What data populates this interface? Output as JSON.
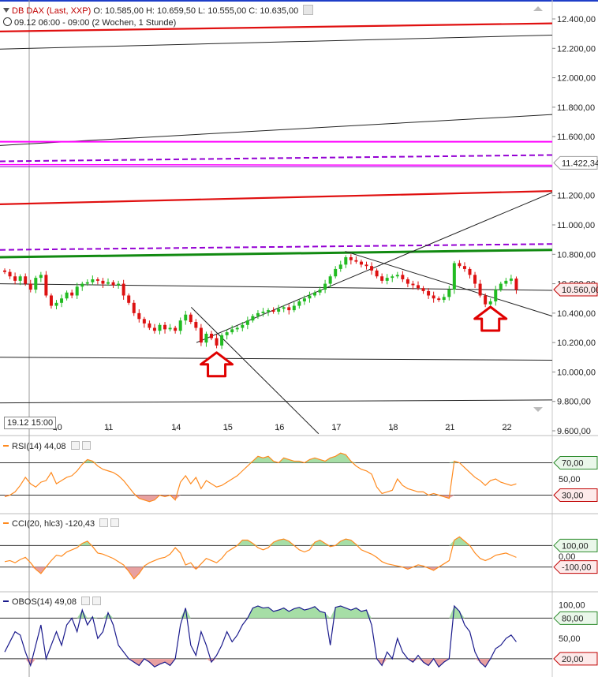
{
  "header": {
    "instrument": "DB DAX (Last, XXP)",
    "ohlc": "O: 10.585,00  H: 10.659,50  L: 10.555,00  C: 10.635,00",
    "period": "09.12 06:00 - 09:00 (2 Wochen, 1 Stunde)"
  },
  "date_marker": "19.12 15:00",
  "colors": {
    "up": "#22bb22",
    "down": "#dd1111",
    "indicator": "#ff8a1e",
    "obos": "#1a1a8c",
    "fill_high": "#a6dea6",
    "fill_low": "#e8a0a0",
    "axis_tag_green": "#2a8a2a",
    "axis_tag_red": "#c00000",
    "arrow": "#e00000"
  },
  "chart_data": [
    {
      "type": "candlestick",
      "title": "DB DAX",
      "y_ticks": [
        "12.400,00",
        "12.200,00",
        "12.000,00",
        "11.800,00",
        "11.600,00",
        "11.200,00",
        "11.000,00",
        "10.800,00",
        "10.600,00",
        "10.400,00",
        "10.200,00",
        "10.000,00",
        "9.800,00",
        "9.600,00"
      ],
      "y_tick_values": [
        12400,
        12200,
        12000,
        11800,
        11600,
        11200,
        11000,
        10800,
        10600,
        10400,
        10200,
        10000,
        9800,
        9600
      ],
      "ylim": [
        9600,
        12400
      ],
      "x_ticks": [
        "10",
        "11",
        "14",
        "15",
        "16",
        "17",
        "18",
        "21",
        "22"
      ],
      "x_tick_index": [
        10,
        20,
        33,
        43,
        53,
        64,
        75,
        86,
        97
      ],
      "tags": [
        {
          "label": "11.422,34",
          "value": 11422,
          "style": "neutral"
        },
        {
          "label": "10.560,00",
          "value": 10560,
          "style": "red"
        }
      ],
      "close": [
        10680,
        10650,
        10620,
        10650,
        10600,
        10560,
        10640,
        10660,
        10520,
        10450,
        10470,
        10500,
        10540,
        10520,
        10580,
        10600,
        10610,
        10630,
        10620,
        10600,
        10610,
        10590,
        10600,
        10520,
        10470,
        10400,
        10360,
        10330,
        10300,
        10280,
        10320,
        10290,
        10300,
        10280,
        10350,
        10390,
        10340,
        10300,
        10200,
        10260,
        10230,
        10180,
        10250,
        10270,
        10290,
        10300,
        10320,
        10350,
        10380,
        10400,
        10410,
        10420,
        10410,
        10430,
        10440,
        10420,
        10450,
        10480,
        10500,
        10520,
        10540,
        10560,
        10600,
        10650,
        10700,
        10730,
        10780,
        10760,
        10750,
        10730,
        10720,
        10690,
        10650,
        10620,
        10640,
        10650,
        10660,
        10630,
        10600,
        10590,
        10570,
        10550,
        10520,
        10500,
        10490,
        10510,
        10560,
        10740,
        10720,
        10700,
        10660,
        10600,
        10520,
        10460,
        10480,
        10560,
        10600,
        10620,
        10635,
        10560
      ],
      "lines": [
        {
          "name": "red-upper",
          "color": "#e01010",
          "width": 2.2,
          "from": [
            0,
            12315
          ],
          "to": [
            104,
            12370
          ]
        },
        {
          "name": "black-upper",
          "color": "#222222",
          "width": 1,
          "from": [
            0,
            12195
          ],
          "to": [
            104,
            12290
          ]
        },
        {
          "name": "black-channel-top",
          "color": "#222222",
          "width": 1,
          "from": [
            0,
            11540
          ],
          "to": [
            104,
            11750
          ]
        },
        {
          "name": "magenta-solid-1",
          "color": "#ff00ff",
          "width": 2,
          "from": [
            0,
            11565
          ],
          "to": [
            104,
            11565
          ]
        },
        {
          "name": "purple-dashed-1",
          "color": "#9400d3",
          "width": 2,
          "dash": "7,4",
          "from": [
            0,
            11432
          ],
          "to": [
            104,
            11475
          ]
        },
        {
          "name": "magenta-solid-2",
          "color": "#ff00ff",
          "width": 1.5,
          "from": [
            0,
            11410
          ],
          "to": [
            104,
            11405
          ]
        },
        {
          "name": "purple-solid-2",
          "color": "#9400d3",
          "width": 1,
          "from": [
            0,
            11395
          ],
          "to": [
            104,
            11395
          ]
        },
        {
          "name": "red-middle",
          "color": "#e01010",
          "width": 2.2,
          "from": [
            0,
            11140
          ],
          "to": [
            104,
            11230
          ]
        },
        {
          "name": "purple-dashed-2",
          "color": "#9400d3",
          "width": 2,
          "dash": "7,4",
          "from": [
            0,
            10830
          ],
          "to": [
            104,
            10870
          ]
        },
        {
          "name": "green-support",
          "color": "#118a11",
          "width": 3,
          "from": [
            0,
            10780
          ],
          "to": [
            104,
            10830
          ]
        },
        {
          "name": "black-horizontal-trend",
          "color": "#222222",
          "width": 1,
          "from": [
            0,
            10600
          ],
          "to": [
            104,
            10555
          ]
        },
        {
          "name": "black-uptrend",
          "color": "#222222",
          "width": 1,
          "from": [
            37,
            10200
          ],
          "to": [
            104,
            11220
          ]
        },
        {
          "name": "black-downtrend-short",
          "color": "#222222",
          "width": 1,
          "from": [
            36,
            10440
          ],
          "to": [
            60,
            9580
          ]
        },
        {
          "name": "black-downtrend-right",
          "color": "#222222",
          "width": 1,
          "from": [
            65,
            10820
          ],
          "to": [
            104,
            10380
          ]
        },
        {
          "name": "black-lower",
          "color": "#222222",
          "width": 1,
          "from": [
            0,
            10100
          ],
          "to": [
            104,
            10080
          ]
        },
        {
          "name": "black-bottom",
          "color": "#222222",
          "width": 1,
          "from": [
            0,
            9790
          ],
          "to": [
            104,
            9810
          ]
        }
      ],
      "arrows": [
        {
          "name": "buy-arrow-1",
          "index": 41,
          "value": 10100
        },
        {
          "name": "buy-arrow-2",
          "index": 94,
          "value": 10410
        }
      ]
    },
    {
      "type": "line",
      "title": "RSI(14)",
      "value_label": "44,08",
      "y_ticks": [
        "70,00",
        "50,00",
        "30,00"
      ],
      "y_tick_values": [
        70,
        50,
        30
      ],
      "ylim": [
        10,
        90
      ],
      "tags": [
        {
          "label": "70,00",
          "value": 70,
          "style": "green"
        },
        {
          "label": "30,00",
          "value": 30,
          "style": "red"
        }
      ],
      "thresholds": [
        70,
        30
      ],
      "values": [
        28,
        30,
        34,
        42,
        52,
        44,
        40,
        46,
        48,
        58,
        44,
        48,
        52,
        54,
        60,
        68,
        74,
        72,
        66,
        62,
        60,
        58,
        54,
        48,
        40,
        32,
        26,
        24,
        22,
        24,
        30,
        28,
        30,
        24,
        46,
        54,
        44,
        52,
        38,
        48,
        44,
        40,
        42,
        46,
        50,
        54,
        60,
        66,
        72,
        78,
        76,
        78,
        72,
        70,
        76,
        74,
        72,
        72,
        70,
        74,
        76,
        74,
        72,
        76,
        78,
        82,
        80,
        72,
        66,
        62,
        60,
        56,
        40,
        32,
        34,
        36,
        50,
        42,
        38,
        36,
        34,
        34,
        30,
        32,
        30,
        28,
        26,
        72,
        70,
        64,
        58,
        52,
        48,
        42,
        48,
        50,
        46,
        44,
        42,
        44
      ]
    },
    {
      "type": "line",
      "title": "CCI(20, hlc3)",
      "value_label": "-120,43",
      "y_ticks": [
        "100,00",
        "0,00",
        "-100,00"
      ],
      "y_tick_values": [
        100,
        0,
        -100
      ],
      "ylim": [
        -300,
        300
      ],
      "tags": [
        {
          "label": "100,00",
          "value": 100,
          "style": "green"
        },
        {
          "label": "-100,00",
          "value": -100,
          "style": "red"
        }
      ],
      "thresholds": [
        100,
        -100
      ],
      "values": [
        -50,
        -40,
        -60,
        -30,
        -10,
        -60,
        -120,
        -160,
        -100,
        -40,
        10,
        0,
        40,
        60,
        80,
        120,
        140,
        90,
        30,
        20,
        0,
        -20,
        -50,
        -80,
        -140,
        -210,
        -160,
        -90,
        -60,
        -40,
        -20,
        -10,
        20,
        80,
        30,
        -80,
        -60,
        -120,
        -70,
        -20,
        -40,
        -60,
        -20,
        40,
        70,
        100,
        150,
        150,
        120,
        80,
        60,
        80,
        130,
        150,
        160,
        140,
        100,
        60,
        40,
        60,
        130,
        150,
        120,
        90,
        100,
        140,
        160,
        150,
        110,
        60,
        40,
        20,
        -10,
        -50,
        -70,
        -80,
        -90,
        -100,
        -120,
        -100,
        -80,
        -90,
        -110,
        -130,
        -100,
        -70,
        -40,
        150,
        180,
        140,
        100,
        30,
        -20,
        -40,
        -20,
        10,
        20,
        30,
        10,
        -10
      ]
    },
    {
      "type": "line",
      "title": "OBOS(14)",
      "value_label": "49,08",
      "y_ticks": [
        "100,00",
        "80,00",
        "50,00",
        "20,00"
      ],
      "y_tick_values": [
        100,
        80,
        50,
        20
      ],
      "ylim": [
        0,
        105
      ],
      "tags": [
        {
          "label": "80,00",
          "value": 80,
          "style": "green"
        },
        {
          "label": "20,00",
          "value": 20,
          "style": "red"
        }
      ],
      "thresholds": [
        80,
        20
      ],
      "values": [
        30,
        45,
        60,
        55,
        30,
        10,
        40,
        70,
        20,
        40,
        60,
        40,
        70,
        80,
        60,
        92,
        70,
        82,
        50,
        60,
        88,
        70,
        40,
        30,
        20,
        15,
        10,
        20,
        15,
        8,
        12,
        15,
        10,
        20,
        70,
        95,
        40,
        25,
        60,
        40,
        15,
        25,
        40,
        60,
        45,
        55,
        70,
        80,
        95,
        98,
        95,
        96,
        90,
        92,
        95,
        90,
        94,
        96,
        92,
        94,
        97,
        90,
        88,
        40,
        96,
        98,
        95,
        92,
        95,
        90,
        92,
        70,
        20,
        10,
        30,
        20,
        50,
        30,
        20,
        15,
        25,
        15,
        10,
        20,
        8,
        15,
        20,
        98,
        90,
        70,
        60,
        30,
        15,
        8,
        20,
        35,
        40,
        50,
        55,
        45
      ]
    }
  ]
}
